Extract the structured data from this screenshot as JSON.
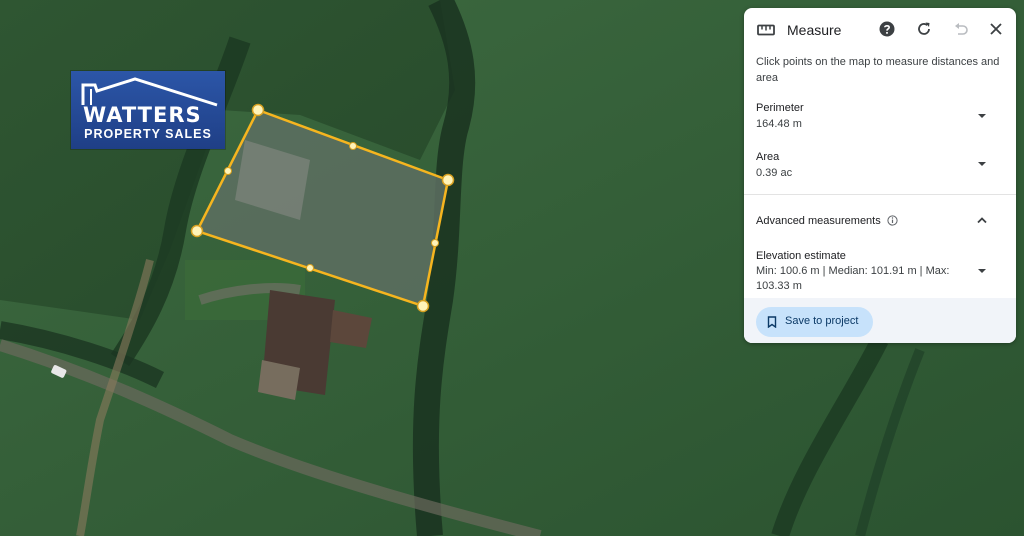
{
  "logo": {
    "name": "WATTERS",
    "sub": "PROPERTY SALES"
  },
  "panel": {
    "title": "Measure",
    "description": "Click points on the map to measure distances and area",
    "perimeter": {
      "label": "Perimeter",
      "value": "164.48 m"
    },
    "area": {
      "label": "Area",
      "value": "0.39 ac"
    },
    "advanced": {
      "label": "Advanced measurements"
    },
    "elevation": {
      "label": "Elevation estimate",
      "value": "Min: 100.6 m | Median: 101.91 m | Max: 103.33 m"
    },
    "save_label": "Save to project"
  },
  "icons": [
    "ruler-icon",
    "help-icon",
    "refresh-icon",
    "undo-icon",
    "close-icon",
    "info-icon",
    "bookmark-icon"
  ],
  "colors": {
    "polygon_stroke": "#f6b51f",
    "vertex": "#fff3b8",
    "save_bg": "#c7e2fb"
  }
}
